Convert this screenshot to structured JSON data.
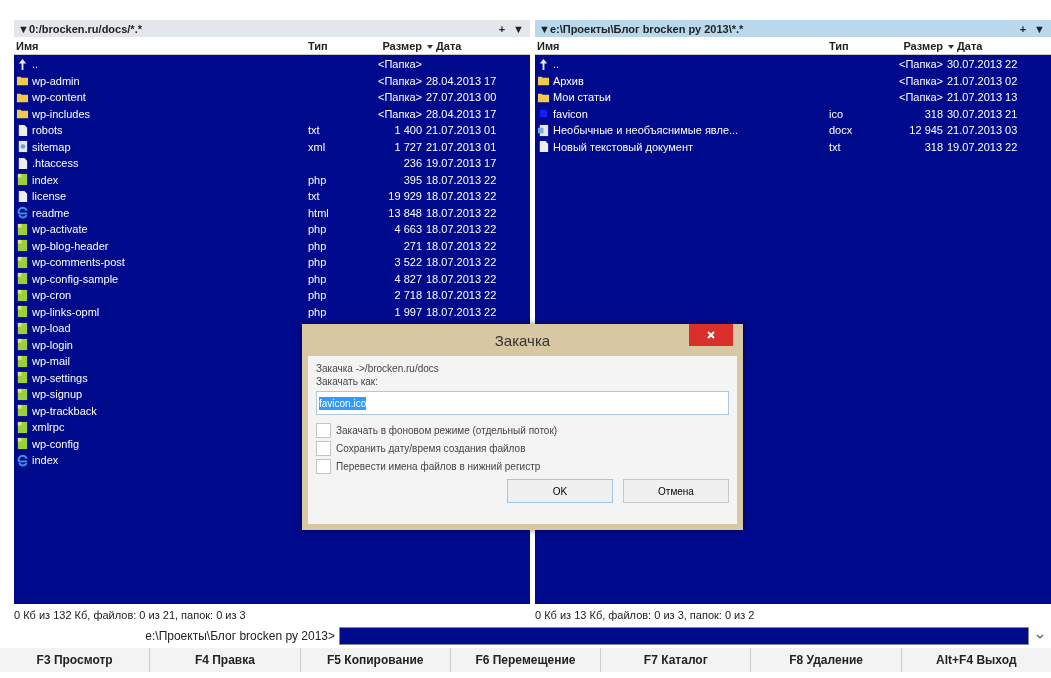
{
  "panels": [
    {
      "path": "▼0:/brocken.ru/docs/*.*",
      "active": false,
      "controls": [
        "+",
        "▼"
      ],
      "columns": [
        {
          "label": "Имя",
          "sorted": false
        },
        {
          "label": "Тип",
          "sorted": false
        },
        {
          "label": "Размер",
          "sorted": false
        },
        {
          "label": "Дата",
          "sorted": true
        }
      ],
      "rows": [
        {
          "kind": "up",
          "name": "..",
          "type": "",
          "size": "<Папка>",
          "date": ""
        },
        {
          "kind": "folder",
          "name": "wp-admin",
          "type": "",
          "size": "<Папка>",
          "date": "28.04.2013 17"
        },
        {
          "kind": "folder",
          "name": "wp-content",
          "type": "",
          "size": "<Папка>",
          "date": "27.07.2013 00"
        },
        {
          "kind": "folder",
          "name": "wp-includes",
          "type": "",
          "size": "<Папка>",
          "date": "28.04.2013 17"
        },
        {
          "kind": "file",
          "name": "robots",
          "type": "txt",
          "size": "1 400",
          "date": "21.07.2013 01"
        },
        {
          "kind": "markup",
          "name": "sitemap",
          "type": "xml",
          "size": "1 727",
          "date": "21.07.2013 01"
        },
        {
          "kind": "file",
          "name": ".htaccess",
          "type": "",
          "size": "236",
          "date": "19.07.2013 17"
        },
        {
          "kind": "script",
          "name": "index",
          "type": "php",
          "size": "395",
          "date": "18.07.2013 22"
        },
        {
          "kind": "file",
          "name": "license",
          "type": "txt",
          "size": "19 929",
          "date": "18.07.2013 22"
        },
        {
          "kind": "web",
          "name": "readme",
          "type": "html",
          "size": "13 848",
          "date": "18.07.2013 22"
        },
        {
          "kind": "script",
          "name": "wp-activate",
          "type": "php",
          "size": "4 663",
          "date": "18.07.2013 22"
        },
        {
          "kind": "script",
          "name": "wp-blog-header",
          "type": "php",
          "size": "271",
          "date": "18.07.2013 22"
        },
        {
          "kind": "script",
          "name": "wp-comments-post",
          "type": "php",
          "size": "3 522",
          "date": "18.07.2013 22"
        },
        {
          "kind": "script",
          "name": "wp-config-sample",
          "type": "php",
          "size": "4 827",
          "date": "18.07.2013 22"
        },
        {
          "kind": "script",
          "name": "wp-cron",
          "type": "php",
          "size": "2 718",
          "date": "18.07.2013 22"
        },
        {
          "kind": "script",
          "name": "wp-links-opml",
          "type": "php",
          "size": "1 997",
          "date": "18.07.2013 22"
        },
        {
          "kind": "script",
          "name": "wp-load"
        },
        {
          "kind": "script",
          "name": "wp-login"
        },
        {
          "kind": "script",
          "name": "wp-mail"
        },
        {
          "kind": "script",
          "name": "wp-settings"
        },
        {
          "kind": "script",
          "name": "wp-signup"
        },
        {
          "kind": "script",
          "name": "wp-trackback"
        },
        {
          "kind": "script",
          "name": "xmlrpc"
        },
        {
          "kind": "script",
          "name": "wp-config"
        },
        {
          "kind": "web",
          "name": "index"
        }
      ],
      "status": "0 Кб из 132 Кб, файлов: 0 из 21, папок: 0 из 3"
    },
    {
      "path": "▼e:\\Проекты\\Блог brocken ру 2013\\*.*",
      "active": true,
      "controls": [
        "+",
        "▼"
      ],
      "columns": [
        {
          "label": "Имя",
          "sorted": false
        },
        {
          "label": "Тип",
          "sorted": false
        },
        {
          "label": "Размер",
          "sorted": false
        },
        {
          "label": "Дата",
          "sorted": true
        }
      ],
      "rows": [
        {
          "kind": "up",
          "name": "..",
          "type": "",
          "size": "<Папка>",
          "date": "30.07.2013 22"
        },
        {
          "kind": "folder",
          "name": "Архив",
          "type": "",
          "size": "<Папка>",
          "date": "21.07.2013 02"
        },
        {
          "kind": "folder",
          "name": "Мои статьи",
          "type": "",
          "size": "<Папка>",
          "date": "21.07.2013 13"
        },
        {
          "kind": "image",
          "name": "favicon",
          "type": "ico",
          "size": "318",
          "date": "30.07.2013 21"
        },
        {
          "kind": "document",
          "name": "Необычные и необъяснимые явле...",
          "type": "docx",
          "size": "12 945",
          "date": "21.07.2013 03"
        },
        {
          "kind": "file",
          "name": "Новый текстовый документ",
          "type": "txt",
          "size": "318",
          "date": "19.07.2013 22"
        }
      ],
      "status": "0 Кб из 13 Кб, файлов: 0 из 3, папок: 0 из 2"
    }
  ],
  "command_line": {
    "prompt": "e:\\Проекты\\Блог brocken ру 2013>"
  },
  "function_keys": [
    "F3 Просмотр",
    "F4 Правка",
    "F5 Копирование",
    "F6 Перемещение",
    "F7 Каталог",
    "F8 Удаление",
    "Alt+F4 Выход"
  ],
  "dialog": {
    "title": "Закачка",
    "target": "Закачка ->/brocken.ru/docs",
    "label": "Закачать как:",
    "value": "favicon.ico",
    "options": [
      {
        "label": "Закачать в фоновом режиме (отдельный поток)",
        "checked": false
      },
      {
        "label": "Сохранить дату/время создания файлов",
        "checked": false
      },
      {
        "label": "Перевести имена файлов в нижний регистр",
        "checked": false
      }
    ],
    "buttons": [
      "OK",
      "Отмена"
    ]
  }
}
